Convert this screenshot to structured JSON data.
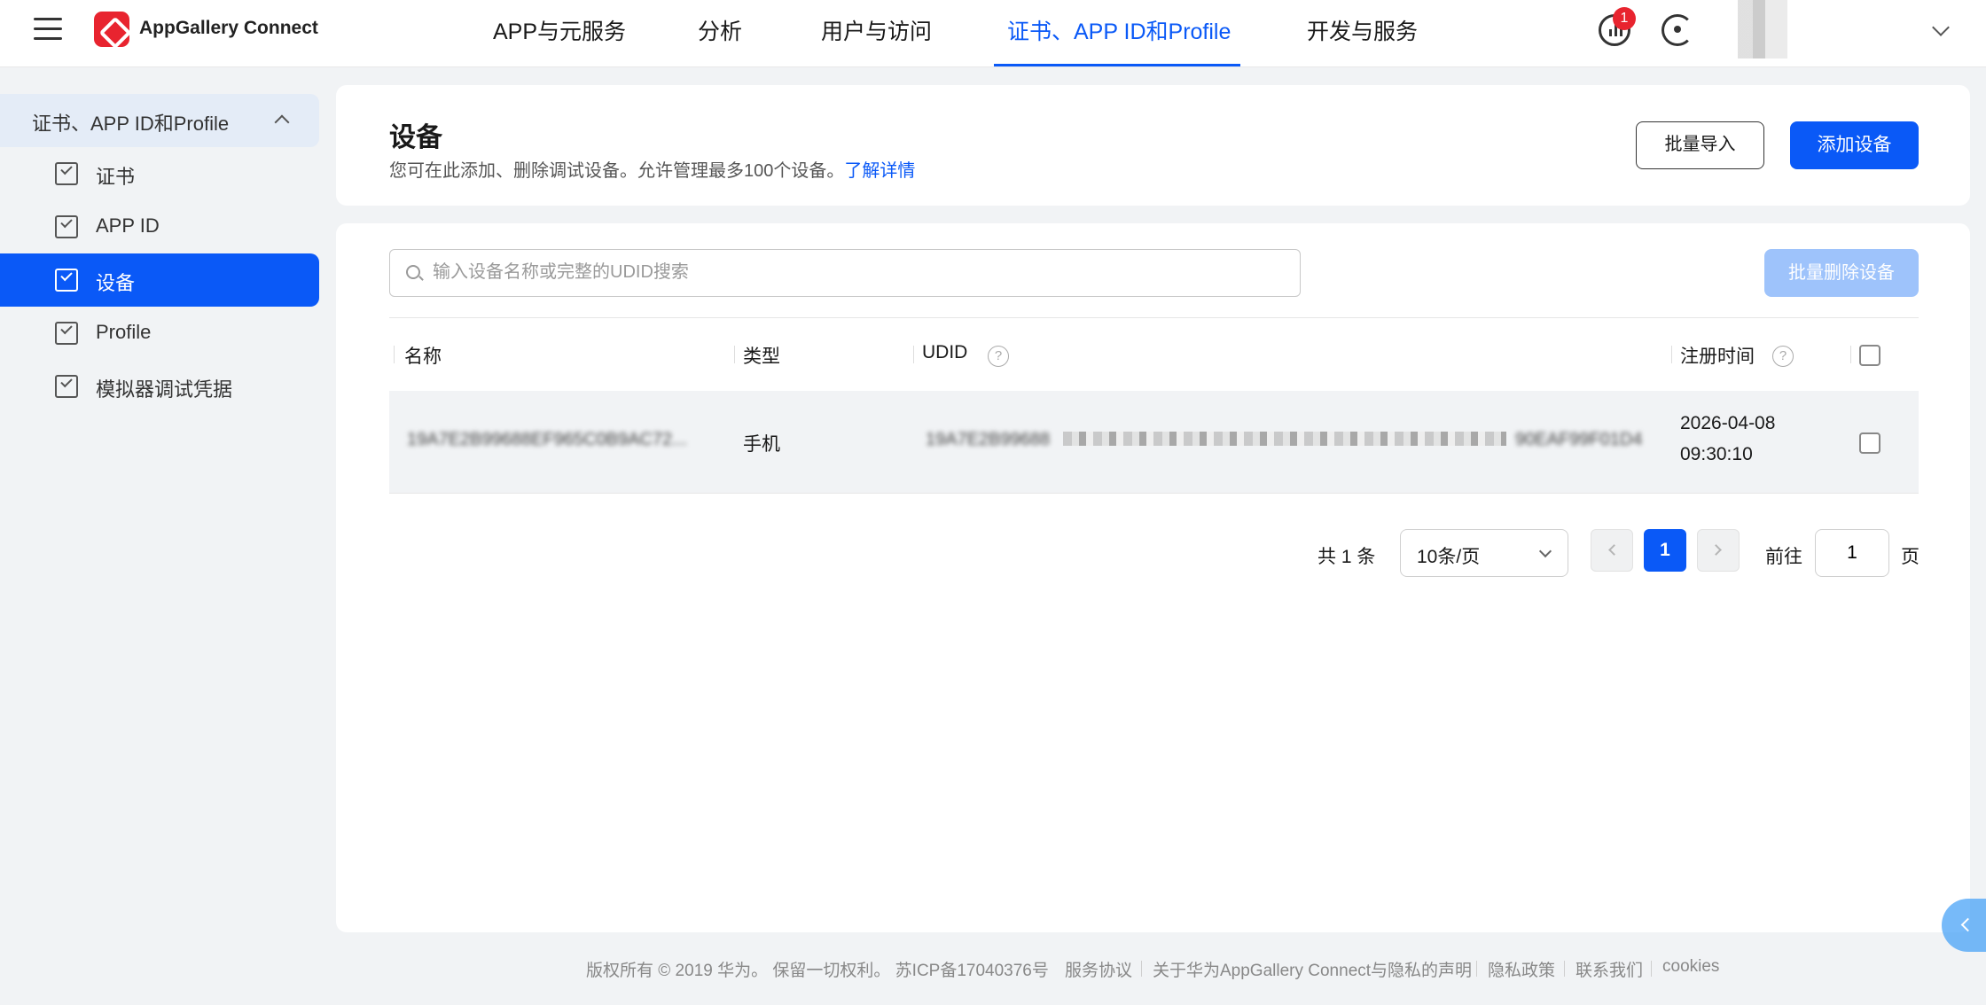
{
  "topbar": {
    "brand": "AppGallery Connect",
    "tabs": [
      {
        "label": "APP与元服务"
      },
      {
        "label": "分析"
      },
      {
        "label": "用户与访问"
      },
      {
        "label": "证书、APP ID和Profile",
        "active": true
      },
      {
        "label": "开发与服务"
      }
    ],
    "notification_count": "1",
    "icons": [
      "menu-icon",
      "appgallery-logo",
      "message-icon",
      "help-icon",
      "chevron-down-icon"
    ]
  },
  "sidebar": {
    "group_label": "证书、APP ID和Profile",
    "items": [
      {
        "label": "证书",
        "active": false
      },
      {
        "label": "APP ID",
        "active": false
      },
      {
        "label": "设备",
        "active": true
      },
      {
        "label": "Profile",
        "active": false
      },
      {
        "label": "模拟器调试凭据",
        "active": false
      }
    ]
  },
  "header": {
    "title": "设备",
    "description": "您可在此添加、删除调试设备。允许管理最多100个设备。",
    "learn_more": "了解详情",
    "import_button": "批量导入",
    "add_button": "添加设备"
  },
  "main": {
    "search_placeholder": "输入设备名称或完整的UDID搜索",
    "batch_delete_button": "批量删除设备",
    "columns": [
      "名称",
      "类型",
      "UDID",
      "注册时间"
    ],
    "rows": [
      {
        "name": "19A7E2B99688EF965C0B9AC72...",
        "type": "手机",
        "udid": "19A7E2B99688",
        "udid_tail": "90EAF99F01D4",
        "registered_date": "2026-04-08",
        "registered_time": "09:30:10"
      }
    ],
    "pagination": {
      "total_prefix": "共",
      "total": "1",
      "total_suffix": "条",
      "page_size": "10条/页",
      "current_page": "1",
      "goto_prefix": "前往",
      "goto_value": "1",
      "goto_suffix": "页"
    }
  },
  "footer": {
    "copyright": "版权所有 © 2019 华为。 保留一切权利。 苏ICP备17040376号",
    "links": [
      "服务协议",
      "关于华为AppGallery Connect与隐私的声明",
      "隐私政策",
      "联系我们",
      "cookies"
    ]
  },
  "colors": {
    "accent": "#0a59f7",
    "brand_red": "#e8242f",
    "disabled_button": "#9ec3fb"
  }
}
